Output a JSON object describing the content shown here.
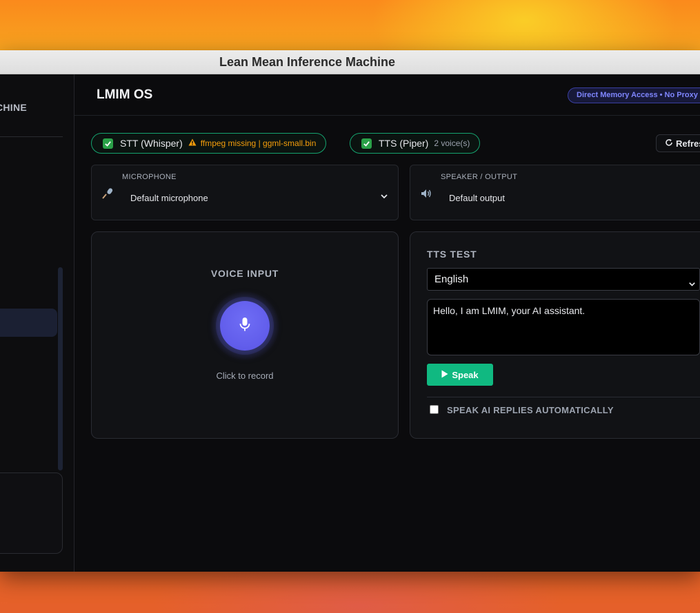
{
  "window": {
    "title": "Lean Mean Inference Machine"
  },
  "sidebar": {
    "brand_fragment": "CHINE"
  },
  "header": {
    "title": "LMIM OS",
    "badge": "Direct Memory Access • No Proxy"
  },
  "status": {
    "stt": {
      "label": "STT (Whisper)",
      "warning": "ffmpeg missing | ggml-small.bin"
    },
    "tts": {
      "label": "TTS (Piper)",
      "detail": "2 voice(s)"
    },
    "refresh_label": "Refresh"
  },
  "devices": {
    "microphone": {
      "label": "MICROPHONE",
      "value": "Default microphone"
    },
    "speaker": {
      "label": "SPEAKER / OUTPUT",
      "value": "Default output"
    }
  },
  "voice_input": {
    "title": "VOICE INPUT",
    "caption": "Click to record"
  },
  "tts_test": {
    "title": "TTS TEST",
    "language": "English",
    "text": "Hello, I am LMIM, your AI assistant.",
    "speak_label": "Speak",
    "auto_label": "SPEAK AI REPLIES AUTOMATICALLY",
    "auto_checked": false
  },
  "colors": {
    "accent_indigo": "#6366f1",
    "success_green": "#10b981",
    "warning_amber": "#f59e0b"
  }
}
